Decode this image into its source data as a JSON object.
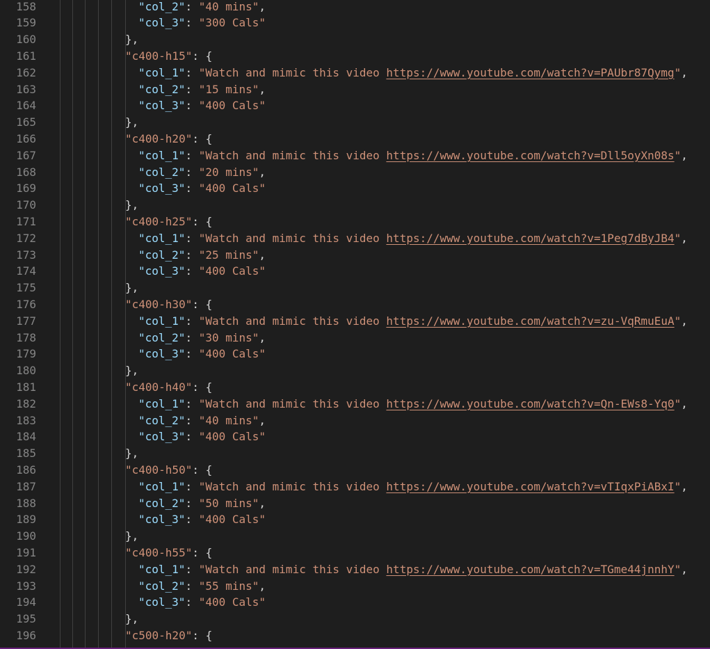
{
  "editor": {
    "lines": [
      {
        "num": "158",
        "indent": 2,
        "key": "\"col_2\"",
        "sep": ": ",
        "value": "\"40 mins\"",
        "tail": ","
      },
      {
        "num": "159",
        "indent": 2,
        "key": "\"col_3\"",
        "sep": ": ",
        "value": "\"300 Cals\"",
        "tail": ""
      },
      {
        "num": "160",
        "indent": 1,
        "text": "},"
      },
      {
        "num": "161",
        "indent": 1,
        "okey": "\"c400-h15\"",
        "otail": ": {"
      },
      {
        "num": "162",
        "indent": 2,
        "key": "\"col_1\"",
        "sep": ": ",
        "value": "\"Watch and mimic this video ",
        "url": "https://www.youtube.com/watch?v=PAUbr87Qymg",
        "after": "\"",
        "tail": ","
      },
      {
        "num": "163",
        "indent": 2,
        "key": "\"col_2\"",
        "sep": ": ",
        "value": "\"15 mins\"",
        "tail": ","
      },
      {
        "num": "164",
        "indent": 2,
        "key": "\"col_3\"",
        "sep": ": ",
        "value": "\"400 Cals\"",
        "tail": ""
      },
      {
        "num": "165",
        "indent": 1,
        "text": "},"
      },
      {
        "num": "166",
        "indent": 1,
        "okey": "\"c400-h20\"",
        "otail": ": {"
      },
      {
        "num": "167",
        "indent": 2,
        "key": "\"col_1\"",
        "sep": ": ",
        "value": "\"Watch and mimic this video ",
        "url": "https://www.youtube.com/watch?v=Dll5oyXn08s",
        "after": "\"",
        "tail": ","
      },
      {
        "num": "168",
        "indent": 2,
        "key": "\"col_2\"",
        "sep": ": ",
        "value": "\"20 mins\"",
        "tail": ","
      },
      {
        "num": "169",
        "indent": 2,
        "key": "\"col_3\"",
        "sep": ": ",
        "value": "\"400 Cals\"",
        "tail": ""
      },
      {
        "num": "170",
        "indent": 1,
        "text": "},"
      },
      {
        "num": "171",
        "indent": 1,
        "okey": "\"c400-h25\"",
        "otail": ": {"
      },
      {
        "num": "172",
        "indent": 2,
        "key": "\"col_1\"",
        "sep": ": ",
        "value": "\"Watch and mimic this video ",
        "url": "https://www.youtube.com/watch?v=1Peg7dByJB4",
        "after": "\"",
        "tail": ","
      },
      {
        "num": "173",
        "indent": 2,
        "key": "\"col_2\"",
        "sep": ": ",
        "value": "\"25 mins\"",
        "tail": ","
      },
      {
        "num": "174",
        "indent": 2,
        "key": "\"col_3\"",
        "sep": ": ",
        "value": "\"400 Cals\"",
        "tail": ""
      },
      {
        "num": "175",
        "indent": 1,
        "text": "},"
      },
      {
        "num": "176",
        "indent": 1,
        "okey": "\"c400-h30\"",
        "otail": ": {"
      },
      {
        "num": "177",
        "indent": 2,
        "key": "\"col_1\"",
        "sep": ": ",
        "value": "\"Watch and mimic this video ",
        "url": "https://www.youtube.com/watch?v=zu-VqRmuEuA",
        "after": "\"",
        "tail": ","
      },
      {
        "num": "178",
        "indent": 2,
        "key": "\"col_2\"",
        "sep": ": ",
        "value": "\"30 mins\"",
        "tail": ","
      },
      {
        "num": "179",
        "indent": 2,
        "key": "\"col_3\"",
        "sep": ": ",
        "value": "\"400 Cals\"",
        "tail": ""
      },
      {
        "num": "180",
        "indent": 1,
        "text": "},"
      },
      {
        "num": "181",
        "indent": 1,
        "okey": "\"c400-h40\"",
        "otail": ": {"
      },
      {
        "num": "182",
        "indent": 2,
        "key": "\"col_1\"",
        "sep": ": ",
        "value": "\"Watch and mimic this video ",
        "url": "https://www.youtube.com/watch?v=Qn-EWs8-Yq0",
        "after": "\"",
        "tail": ","
      },
      {
        "num": "183",
        "indent": 2,
        "key": "\"col_2\"",
        "sep": ": ",
        "value": "\"40 mins\"",
        "tail": ","
      },
      {
        "num": "184",
        "indent": 2,
        "key": "\"col_3\"",
        "sep": ": ",
        "value": "\"400 Cals\"",
        "tail": ""
      },
      {
        "num": "185",
        "indent": 1,
        "text": "},"
      },
      {
        "num": "186",
        "indent": 1,
        "okey": "\"c400-h50\"",
        "otail": ": {"
      },
      {
        "num": "187",
        "indent": 2,
        "key": "\"col_1\"",
        "sep": ": ",
        "value": "\"Watch and mimic this video ",
        "url": "https://www.youtube.com/watch?v=vTIqxPiABxI",
        "after": "\"",
        "tail": ","
      },
      {
        "num": "188",
        "indent": 2,
        "key": "\"col_2\"",
        "sep": ": ",
        "value": "\"50 mins\"",
        "tail": ","
      },
      {
        "num": "189",
        "indent": 2,
        "key": "\"col_3\"",
        "sep": ": ",
        "value": "\"400 Cals\"",
        "tail": ""
      },
      {
        "num": "190",
        "indent": 1,
        "text": "},"
      },
      {
        "num": "191",
        "indent": 1,
        "okey": "\"c400-h55\"",
        "otail": ": {"
      },
      {
        "num": "192",
        "indent": 2,
        "key": "\"col_1\"",
        "sep": ": ",
        "value": "\"Watch and mimic this video ",
        "url": "https://www.youtube.com/watch?v=TGme44jnnhY",
        "after": "\"",
        "tail": ","
      },
      {
        "num": "193",
        "indent": 2,
        "key": "\"col_2\"",
        "sep": ": ",
        "value": "\"55 mins\"",
        "tail": ","
      },
      {
        "num": "194",
        "indent": 2,
        "key": "\"col_3\"",
        "sep": ": ",
        "value": "\"400 Cals\"",
        "tail": ""
      },
      {
        "num": "195",
        "indent": 1,
        "text": "},"
      },
      {
        "num": "196",
        "indent": 1,
        "okey": "\"c500-h20\"",
        "otail": ": {"
      }
    ]
  }
}
